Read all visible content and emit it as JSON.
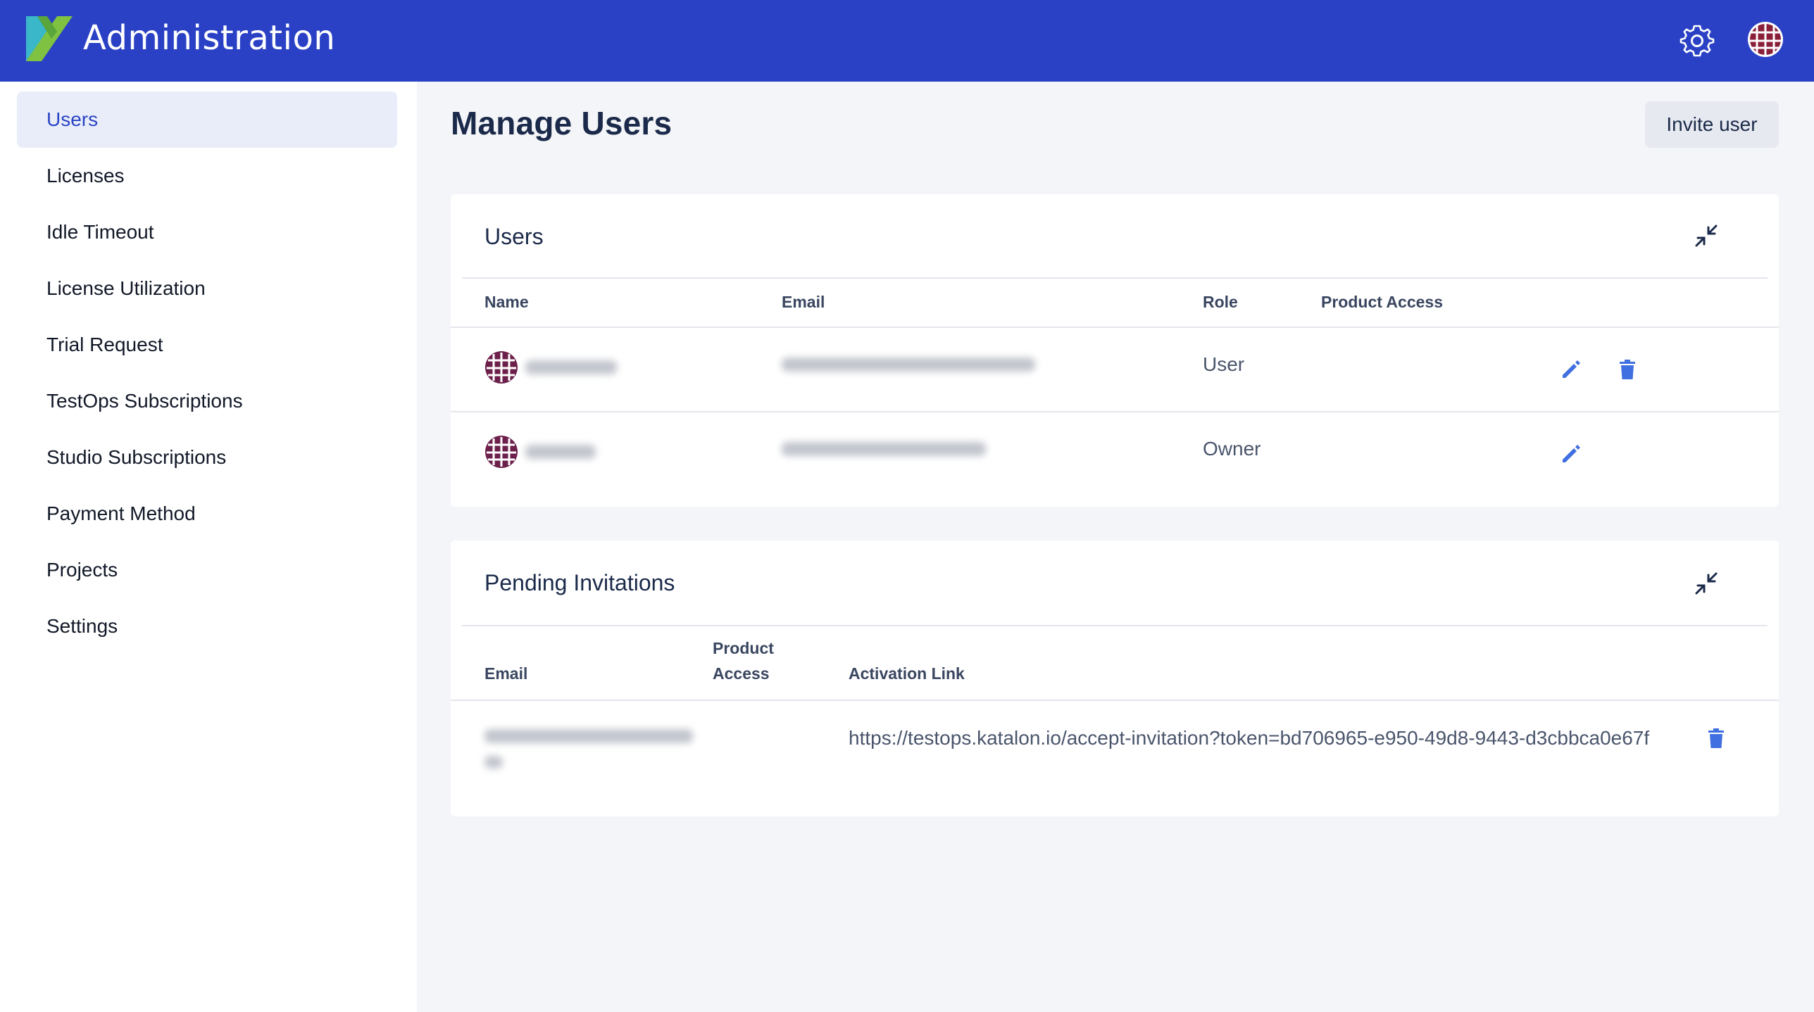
{
  "header": {
    "title": "Administration",
    "settings_icon": "gear-icon",
    "avatar_icon": "avatar-icon",
    "brand_color": "#2a41c5"
  },
  "sidebar": {
    "items": [
      {
        "label": "Users",
        "active": true
      },
      {
        "label": "Licenses",
        "active": false
      },
      {
        "label": "Idle Timeout",
        "active": false
      },
      {
        "label": "License Utilization",
        "active": false
      },
      {
        "label": "Trial Request",
        "active": false
      },
      {
        "label": "TestOps Subscriptions",
        "active": false
      },
      {
        "label": "Studio Subscriptions",
        "active": false
      },
      {
        "label": "Payment Method",
        "active": false
      },
      {
        "label": "Projects",
        "active": false
      },
      {
        "label": "Settings",
        "active": false
      }
    ]
  },
  "main": {
    "title": "Manage Users",
    "invite_button": "Invite user"
  },
  "users_card": {
    "title": "Users",
    "columns": [
      "Name",
      "Email",
      "Role",
      "Product Access"
    ],
    "rows": [
      {
        "role": "User",
        "can_delete": true
      },
      {
        "role": "Owner",
        "can_delete": false
      }
    ]
  },
  "pending_card": {
    "title": "Pending Invitations",
    "columns": {
      "email": "Email",
      "product_access_1": "Product",
      "product_access_2": "Access",
      "activation_link": "Activation Link"
    },
    "rows": [
      {
        "activation_link": "https://testops.katalon.io/accept-invitation?token=bd706965-e950-49d8-9443-d3cbbca0e67f"
      }
    ]
  },
  "colors": {
    "accent": "#2a44c3",
    "action_icon": "#3f6fe0"
  }
}
